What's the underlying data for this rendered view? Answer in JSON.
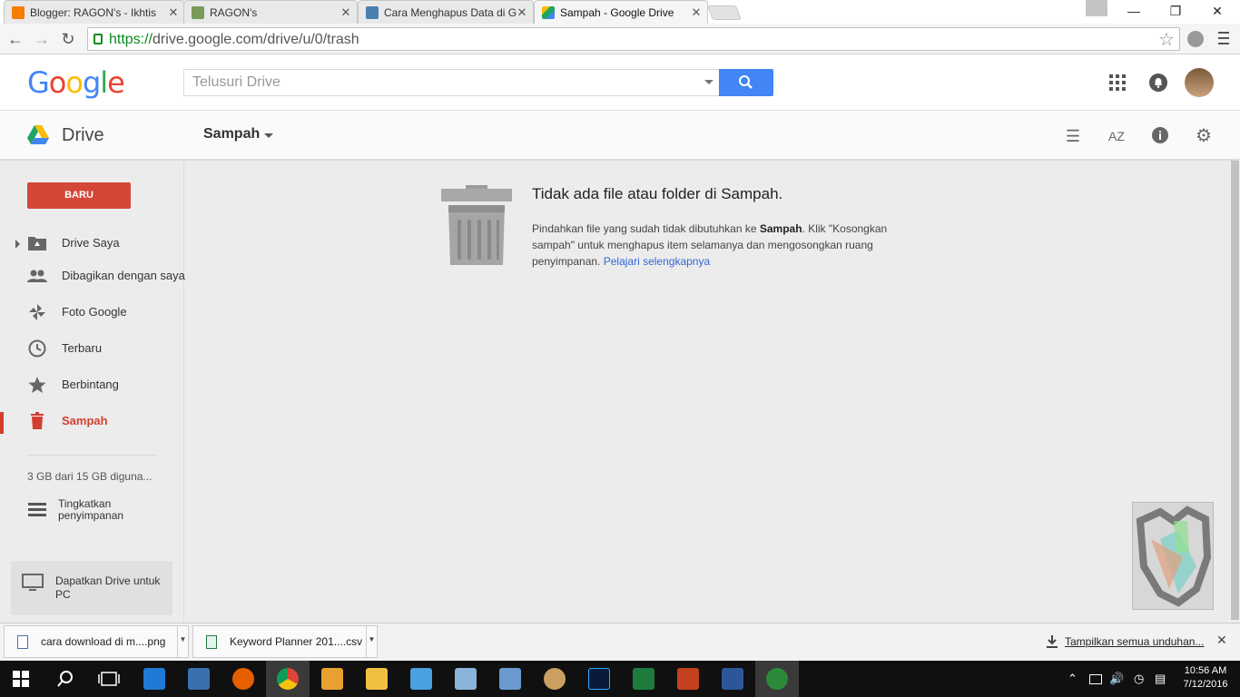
{
  "browser": {
    "tabs": [
      {
        "title": "Blogger: RAGON's - Ikhtis",
        "icon": "blogger-icon",
        "color": "#f57d00"
      },
      {
        "title": "RAGON's",
        "icon": "site-favicon",
        "color": "#7a9a5a"
      },
      {
        "title": "Cara Menghapus Data di G",
        "icon": "plane-favicon",
        "color": "#4a7fb0"
      },
      {
        "title": "Sampah - Google Drive",
        "icon": "drive-icon",
        "color": "#1fa463"
      }
    ],
    "close_glyph": "✕",
    "url_scheme": "https://",
    "url_rest": "drive.google.com/drive/u/0/trash"
  },
  "header": {
    "logo_letters": [
      "G",
      "o",
      "o",
      "g",
      "l",
      "e"
    ],
    "logo_colors": [
      "#4285f4",
      "#ea4335",
      "#fbbc05",
      "#4285f4",
      "#34a853",
      "#ea4335"
    ],
    "search_placeholder": "Telusuri Drive"
  },
  "drivebar": {
    "app_name": "Drive",
    "breadcrumb": "Sampah"
  },
  "sidebar": {
    "new_button": "BARU",
    "items": [
      {
        "label": "Drive Saya",
        "icon": "drive-folder-icon"
      },
      {
        "label": "Dibagikan dengan saya",
        "icon": "people-icon"
      },
      {
        "label": "Foto Google",
        "icon": "pinwheel-icon"
      },
      {
        "label": "Terbaru",
        "icon": "clock-icon"
      },
      {
        "label": "Berbintang",
        "icon": "star-icon"
      },
      {
        "label": "Sampah",
        "icon": "trash-icon"
      }
    ],
    "active_index": 5,
    "quota": "3 GB dari 15 GB diguna...",
    "upgrade": "Tingkatkan penyimpanan",
    "get_drive": "Dapatkan Drive untuk PC"
  },
  "main": {
    "empty_title": "Tidak ada file atau folder di Sampah.",
    "body_prefix": "Pindahkan file yang sudah tidak dibutuhkan ke ",
    "body_bold": "Sampah",
    "body_suffix": ". Klik \"Kosongkan sampah\" untuk menghapus item selamanya dan mengosongkan ruang penyimpanan. ",
    "learn_more": "Pelajari selengkapnya"
  },
  "downloads": {
    "items": [
      {
        "name": "cara download di m....png"
      },
      {
        "name": "Keyword Planner 201....csv"
      }
    ],
    "show_all": "Tampilkan semua unduhan..."
  },
  "taskbar": {
    "time": "10:56 AM",
    "date": "7/12/2016"
  }
}
